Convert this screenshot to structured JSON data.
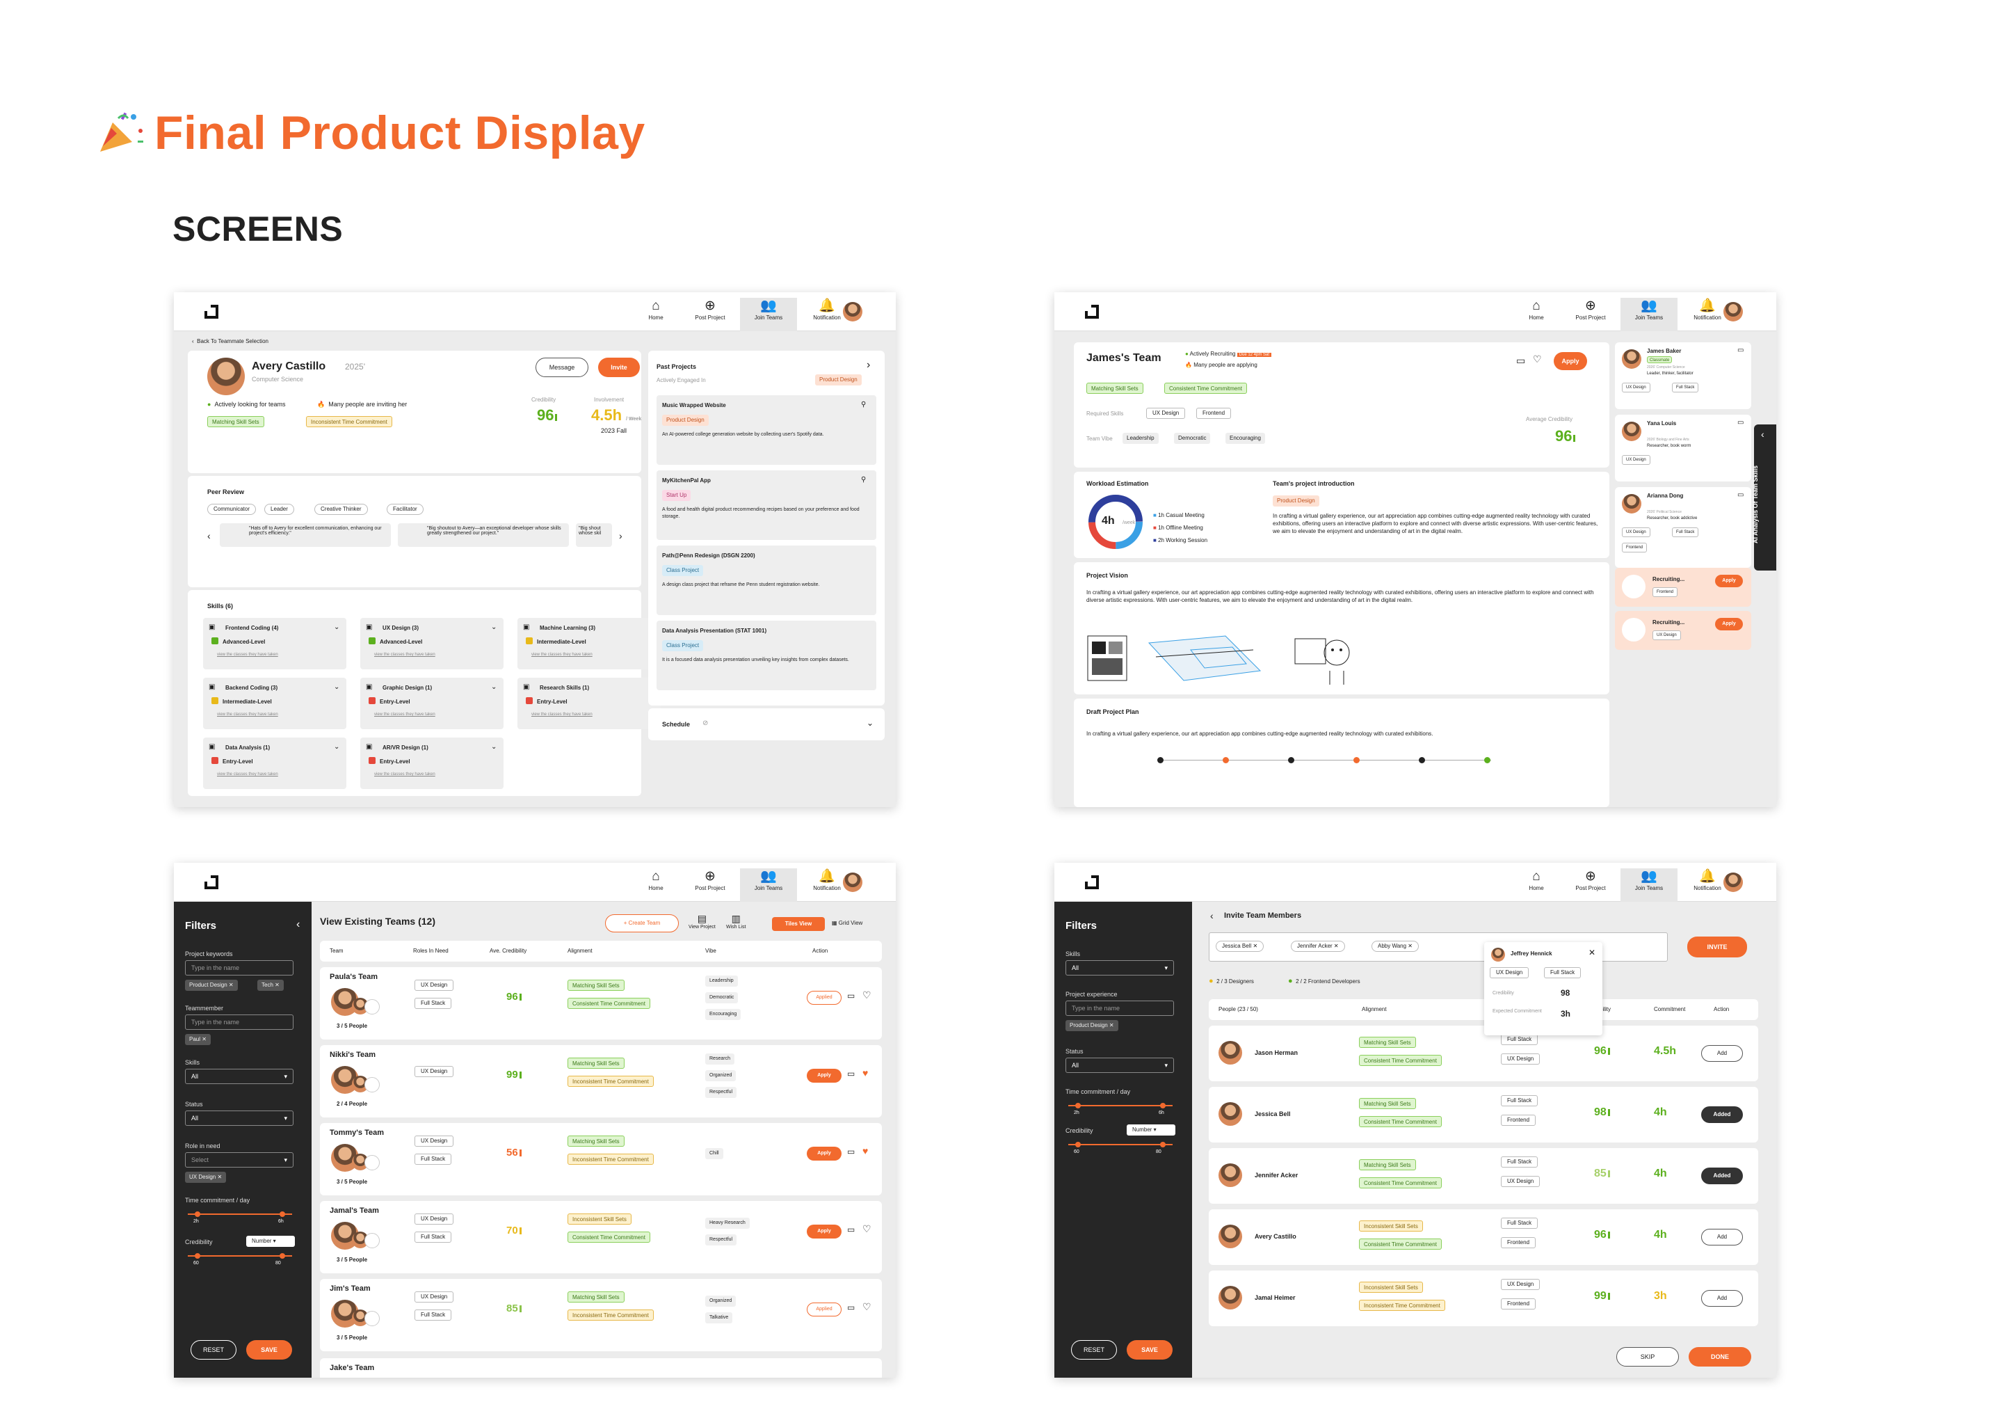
{
  "header": {
    "title_orange": "Final Product Display",
    "title_dark": "",
    "subtitle": "SCREENS"
  },
  "nav": {
    "home": "Home",
    "post": "Post Project",
    "join": "Join Teams",
    "notification": "Notification"
  },
  "s1": {
    "back": "Back To Teammate Selection",
    "name": "Avery Castillo",
    "year": "2025'",
    "major": "Computer Science",
    "status1": "Actively looking for teams",
    "status2": "Many people are inviting her",
    "tag1": "Matching Skill Sets",
    "tag2": "Inconsistent Time Commitment",
    "message": "Message",
    "invite": "Invite",
    "cred_label": "Credibility",
    "cred": "96",
    "inv_label": "Involvement",
    "inv": "4.5h",
    "inv_unit": "/ Week",
    "term": "2023 Fall",
    "peer_title": "Peer Review",
    "peer_tags": [
      "Communicator",
      "Leader",
      "Creative Thinker",
      "Facilitator"
    ],
    "quotes": [
      "\"Hats off to Avery for excellent communication, enhancing our project's efficiency.\"",
      "\"Big shoutout to Avery—an exceptional developer whose skills greatly strengthened our project.\"",
      "\"Big shout whose skil"
    ],
    "skills_title": "Skills (6)",
    "skills": [
      {
        "name": "Frontend Coding (4)",
        "level": "Advanced-Level"
      },
      {
        "name": "UX Design (3)",
        "level": "Advanced-Level"
      },
      {
        "name": "Machine Learning (3)",
        "level": "Intermediate-Level"
      },
      {
        "name": "Backend Coding (3)",
        "level": "Intermediate-Level"
      },
      {
        "name": "Graphic Design (1)",
        "level": "Entry-Level"
      },
      {
        "name": "Research Skills (1)",
        "level": "Entry-Level"
      },
      {
        "name": "Data Analysis (1)",
        "level": "Entry-Level"
      },
      {
        "name": "AR/VR Design (1)",
        "level": "Entry-Level"
      }
    ],
    "skill_link": "view the classes they have taken",
    "past_title": "Past Projects",
    "engaged": "Actively Engaged In",
    "engaged_tag": "Product Design",
    "projects": [
      {
        "title": "Music Wrapped Website",
        "tag": "Product Design",
        "desc": "An AI-powered college generation website by collecting user's Spotify data."
      },
      {
        "title": "MyKitchenPal App",
        "tag": "Start Up",
        "desc": "A food and health digital product recommending recipes based on your preference and food storage."
      },
      {
        "title": "Path@Penn Redesign (DSGN 2200)",
        "tag": "Class Project",
        "desc": "A design class project that reframe the Penn student registration website."
      },
      {
        "title": "Data Analysis Presentation (STAT 1001)",
        "tag": "Class Project",
        "desc": "It is a focused data analysis presentation unveiling key insights from complex datasets."
      }
    ],
    "schedule": "Schedule"
  },
  "s2": {
    "team": "James's Team",
    "recruit": "Actively Recruiting",
    "due": "Due 12 4pm Sat",
    "applying": "Many people are applying",
    "tag1": "Matching Skill Sets",
    "tag2": "Consistent Time Commitment",
    "req_label": "Required Skills",
    "req": [
      "UX Design",
      "Frontend"
    ],
    "vibe_label": "Team Vibe",
    "vibes": [
      "Leadership",
      "Democratic",
      "Encouraging"
    ],
    "avg_label": "Average Credibility",
    "avg": "96",
    "apply": "Apply",
    "workload": "Workload Estimation",
    "hours": "4h",
    "per": "/week",
    "legend": [
      "1h Casual Meeting",
      "1h Offline Meeting",
      "2h Working Session"
    ],
    "intro_title": "Team's project introduction",
    "intro_tag": "Product Design",
    "intro": "In crafting a virtual gallery experience, our art appreciation app combines cutting-edge augmented reality technology with curated exhibitions, offering users an interactive platform to explore and connect with diverse artistic expressions. With user-centric features, we aim to elevate the enjoyment and understanding of art in the digital realm.",
    "vision_title": "Project Vision",
    "vision": "In crafting a virtual gallery experience, our art appreciation app combines cutting-edge augmented reality technology with curated exhibitions, offering users an interactive platform to explore and connect with diverse artistic expressions. With user-centric features, we aim to elevate the enjoyment and understanding of art in the digital realm.",
    "draft_title": "Draft Project Plan",
    "draft": "In crafting a virtual gallery experience, our art appreciation app combines cutting-edge augmented reality technology with curated exhibitions.",
    "members": [
      {
        "name": "James Baker",
        "badge": "Classmate",
        "sub": "2026' Computer Science",
        "trait": "Leader, thinker, facilitator",
        "skills": [
          "UX Design",
          "Full Stack"
        ]
      },
      {
        "name": "Yana Louis",
        "badge": "",
        "sub": "2026' Biology and Fine Arts",
        "trait": "Researcher, book worm",
        "skills": [
          "UX Design"
        ]
      },
      {
        "name": "Arianna Dong",
        "badge": "",
        "sub": "2026' Political Science",
        "trait": "Researcher, book addictive",
        "skills": [
          "UX Design",
          "Full Stack",
          "Frontend"
        ]
      }
    ],
    "recruiting": [
      {
        "label": "Recruiting...",
        "skill": "Frontend"
      },
      {
        "label": "Recruiting...",
        "skill": "UX Design"
      }
    ],
    "ai_tab": "AI Analysis Of Team Skills"
  },
  "s3": {
    "filters": "Filters",
    "kw_label": "Project keywords",
    "kw_ph": "Type in the name",
    "kw_chips": [
      "Product Design",
      "Tech"
    ],
    "tm_label": "Teammember",
    "tm_ph": "Type in the name",
    "tm_chip": "Paul",
    "skills_label": "Skills",
    "skills_val": "All",
    "status_label": "Status",
    "status_val": "All",
    "role_label": "Role in need",
    "role_ph": "Select",
    "role_chip": "UX Design",
    "time_label": "Time commitment / day",
    "time_min": "2h",
    "time_max": "6h",
    "cred_label": "Credibility",
    "cred_sel": "Number",
    "cred_min": "60",
    "cred_max": "80",
    "reset": "RESET",
    "save": "SAVE",
    "title": "View Existing Teams (12)",
    "create": "+ Create Team",
    "view_project": "View Project",
    "wishlist": "Wish List",
    "tiles": "Tiles View",
    "grid": "Grid View",
    "cols": [
      "Team",
      "Roles In Need",
      "Ave. Credibility",
      "Alignment",
      "Vibe",
      "Action"
    ],
    "teams": [
      {
        "name": "Paula's Team",
        "people": "3 / 5 People",
        "roles": [
          "UX Design",
          "Full Stack"
        ],
        "cred": "96",
        "align": [
          "Matching Skill Sets",
          "Consistent Time Commitment"
        ],
        "vibe": [
          "Leadership",
          "Democratic",
          "Encouraging"
        ],
        "action": "Applied"
      },
      {
        "name": "Nikki's Team",
        "people": "2 / 4 People",
        "roles": [
          "UX Design"
        ],
        "cred": "99",
        "align": [
          "Matching Skill Sets",
          "Inconsistent Time Commitment"
        ],
        "vibe": [
          "Research",
          "Organized",
          "Respectful"
        ],
        "action": "Apply"
      },
      {
        "name": "Tommy's Team",
        "people": "3 / 5 People",
        "roles": [
          "UX Design",
          "Full Stack"
        ],
        "cred": "56",
        "align": [
          "Matching Skill Sets",
          "Inconsistent Time Commitment"
        ],
        "vibe": [
          "Chill"
        ],
        "action": "Apply"
      },
      {
        "name": "Jamal's Team",
        "people": "3 / 5 People",
        "roles": [
          "UX Design",
          "Full Stack"
        ],
        "cred": "70",
        "align": [
          "Inconsistent Skill Sets",
          "Consistent Time Commitment"
        ],
        "vibe": [
          "Heavy Research",
          "Respectful"
        ],
        "action": "Apply"
      },
      {
        "name": "Jim's Team",
        "people": "3 / 5 People",
        "roles": [
          "UX Design",
          "Full Stack"
        ],
        "cred": "85",
        "align": [
          "Matching Skill Sets",
          "Inconsistent Time Commitment"
        ],
        "vibe": [
          "Organized",
          "Talkative"
        ],
        "action": "Applied"
      }
    ],
    "last_team": "Jake's Team"
  },
  "s4": {
    "filters": "Filters",
    "skills_label": "Skills",
    "skills_val": "All",
    "exp_label": "Project experience",
    "exp_ph": "Type in the name",
    "exp_chip": "Product Design",
    "status_label": "Status",
    "status_val": "All",
    "time_label": "Time commitment / day",
    "time_min": "2h",
    "time_max": "6h",
    "cred_label": "Credibility",
    "cred_sel": "Number",
    "cred_min": "60",
    "cred_max": "80",
    "reset": "RESET",
    "save": "SAVE",
    "title": "Invite Team Members",
    "invite": "INVITE",
    "chips": [
      "Jessica Bell",
      "Jennifer Acker",
      "Abby Wang"
    ],
    "prog1": "2 / 3 Designers",
    "prog2": "2 / 2 Frontend Developers",
    "popup": {
      "name": "Jeffrey Hennick",
      "skills": [
        "UX Design",
        "Full Stack"
      ],
      "cred_label": "Credibility",
      "cred": "98",
      "commit_label": "Expected Commitment",
      "commit": "3h"
    },
    "cols": [
      "People (23 / 50)",
      "Alignment",
      "bility",
      "Commitment",
      "Action"
    ],
    "people": [
      {
        "name": "Jason Herman",
        "align": [
          "Matching Skill Sets",
          "Consistent Time Commitment"
        ],
        "skills": [
          "Full Stack",
          "UX Design"
        ],
        "cred": "96",
        "commit": "4.5h",
        "action": "Add"
      },
      {
        "name": "Jessica Bell",
        "align": [
          "Matching Skill Sets",
          "Consistent Time Commitment"
        ],
        "skills": [
          "Full Stack",
          "Frontend"
        ],
        "cred": "98",
        "commit": "4h",
        "action": "Added"
      },
      {
        "name": "Jennifer Acker",
        "align": [
          "Matching Skill Sets",
          "Consistent Time Commitment"
        ],
        "skills": [
          "Full Stack",
          "UX Design"
        ],
        "cred": "85",
        "commit": "4h",
        "action": "Added"
      },
      {
        "name": "Avery Castillo",
        "align": [
          "Inconsistent Skill Sets",
          "Consistent Time Commitment"
        ],
        "skills": [
          "Full Stack",
          "Frontend"
        ],
        "cred": "96",
        "commit": "4h",
        "action": "Add"
      },
      {
        "name": "Jamal Heimer",
        "align": [
          "Inconsistent Skill Sets",
          "Inconsistent Time Commitment"
        ],
        "skills": [
          "UX Design",
          "Frontend"
        ],
        "cred": "99",
        "commit": "3h",
        "action": "Add"
      }
    ],
    "skip": "SKIP",
    "done": "DONE"
  }
}
